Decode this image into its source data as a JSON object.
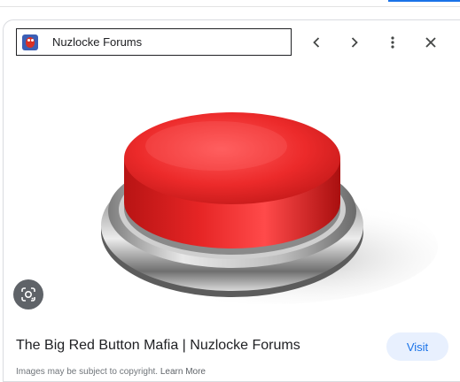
{
  "header": {
    "site_name": "Nuzlocke Forums",
    "favicon_icon": "nuzlocke-forums-favicon"
  },
  "nav": {
    "back_icon": "chevron-left-icon",
    "forward_icon": "chevron-right-icon",
    "more_icon": "more-vert-icon",
    "close_icon": "close-icon"
  },
  "image": {
    "subject": "red-push-button",
    "lens_icon": "google-lens-icon"
  },
  "result": {
    "title": "The Big Red Button Mafia | Nuzlocke Forums",
    "visit_label": "Visit",
    "copyright_text": "Images may be subject to copyright.",
    "learn_more_label": "Learn More"
  },
  "colors": {
    "accent": "#1a73e8",
    "visit_bg": "#e8f0fe",
    "button_red": "#e62525"
  }
}
